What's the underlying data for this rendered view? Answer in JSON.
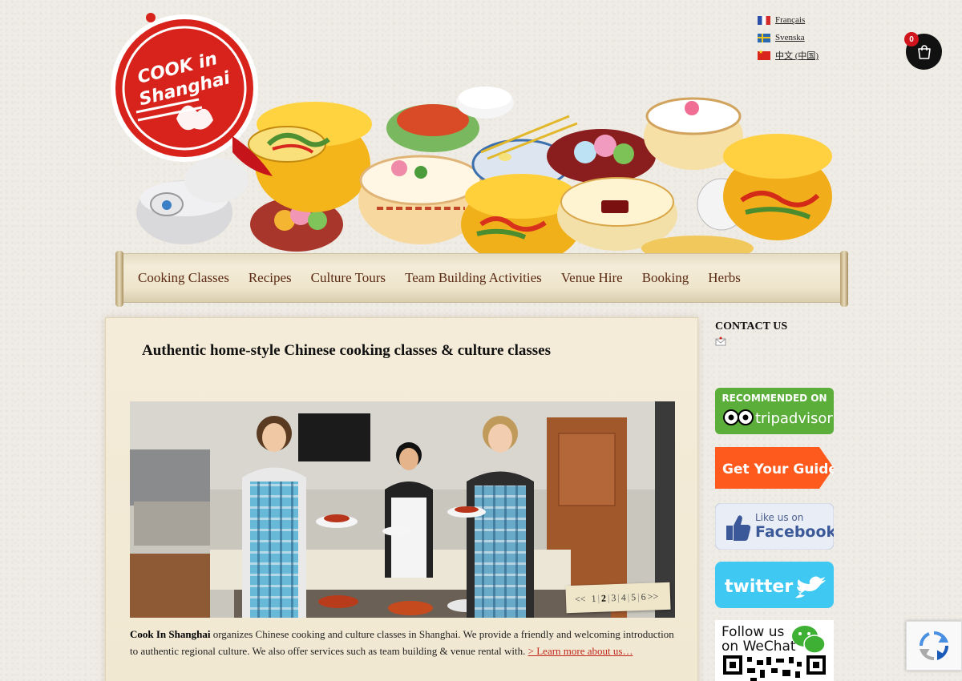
{
  "languages": [
    {
      "label": "Français",
      "flag": "france-flag-icon"
    },
    {
      "label": "Svenska",
      "flag": "sweden-flag-icon"
    },
    {
      "label": "中文 (中国)",
      "flag": "china-flag-icon"
    }
  ],
  "cart": {
    "count": "0",
    "icon": "shopping-bag-icon"
  },
  "logo": {
    "line1": "COOK in",
    "line2": "Shanghai",
    "brand_color": "#d8231d"
  },
  "nav": {
    "items": [
      "Cooking Classes",
      "Recipes",
      "Culture Tours",
      "Team Building Activities",
      "Venue Hire",
      "Booking",
      "Herbs"
    ]
  },
  "main": {
    "title": "Authentic home-style Chinese cooking classes & culture classes",
    "slider": {
      "prev": "<<",
      "next": ">>",
      "pages": [
        "1",
        "2",
        "3",
        "4",
        "5",
        "6"
      ],
      "active_page": "2"
    },
    "intro": {
      "brand": "Cook In Shanghai",
      "text": " organizes Chinese cooking and culture classes in Shanghai. We provide a friendly and welcoming introduction to authentic regional culture. We also offer services such as team building & venue rental with. ",
      "link": "> Learn more about us…"
    }
  },
  "sidebar": {
    "heading": "CONTACT US",
    "tripadvisor": {
      "line1": "RECOMMENDED ON",
      "line2": "tripadvisor",
      "color": "#5cae3b"
    },
    "getyourguide": {
      "label": "Get Your Guide",
      "color": "#ff5a1e"
    },
    "facebook": {
      "line1": "Like us on",
      "line2": "Facebook"
    },
    "twitter": {
      "label": "twitter",
      "color": "#3fc8f2"
    },
    "wechat": {
      "line1": "Follow us",
      "line2": "on WeChat"
    }
  }
}
